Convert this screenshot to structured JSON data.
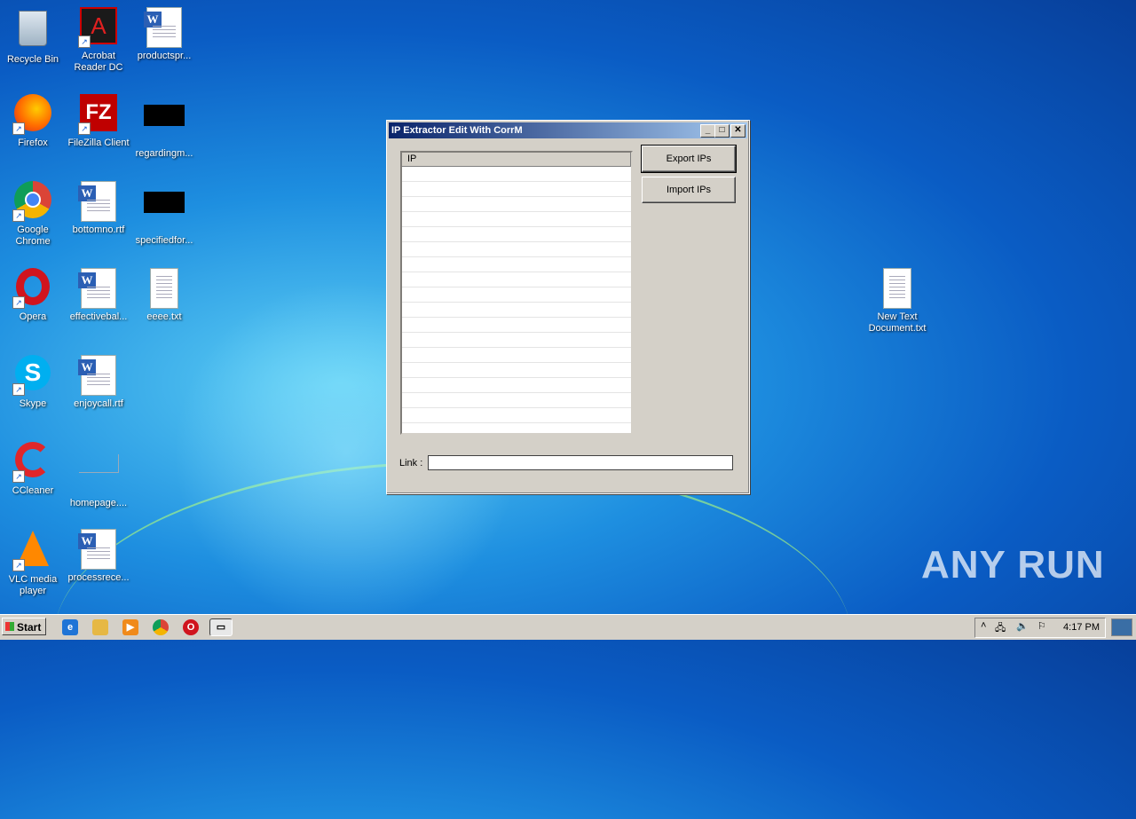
{
  "desktop_icons": [
    {
      "label": "Recycle Bin",
      "icon": "recycle-bin-icon"
    },
    {
      "label": "Acrobat Reader DC",
      "icon": "acrobat-icon"
    },
    {
      "label": "productspr...",
      "icon": "word-doc-icon"
    },
    {
      "label": "Firefox",
      "icon": "firefox-icon"
    },
    {
      "label": "FileZilla Client",
      "icon": "filezilla-icon"
    },
    {
      "label": "regardingm...",
      "icon": "redacted-icon"
    },
    {
      "label": "Google Chrome",
      "icon": "chrome-icon"
    },
    {
      "label": "bottomno.rtf",
      "icon": "word-doc-icon"
    },
    {
      "label": "specifiedfor...",
      "icon": "redacted-icon"
    },
    {
      "label": "Opera",
      "icon": "opera-icon"
    },
    {
      "label": "effectivebal...",
      "icon": "word-doc-icon"
    },
    {
      "label": "eeee.txt",
      "icon": "text-file-icon"
    },
    {
      "label": "Skype",
      "icon": "skype-icon"
    },
    {
      "label": "enjoycall.rtf",
      "icon": "word-doc-icon"
    },
    {
      "label": "CCleaner",
      "icon": "ccleaner-icon"
    },
    {
      "label": "homepage....",
      "icon": "blank-file-icon"
    },
    {
      "label": "VLC media player",
      "icon": "vlc-icon"
    },
    {
      "label": "processrece...",
      "icon": "word-doc-icon"
    },
    {
      "label": "New Text Document.txt",
      "icon": "text-file-icon"
    }
  ],
  "window": {
    "title": "IP Extractor Edit With CorrM",
    "list_header": "IP",
    "export_label": "Export IPs",
    "import_label": "Import IPs",
    "link_label": "Link :",
    "link_value": ""
  },
  "taskbar": {
    "start_label": "Start",
    "clock": "4:17 PM"
  },
  "watermark": "ANY RUN"
}
